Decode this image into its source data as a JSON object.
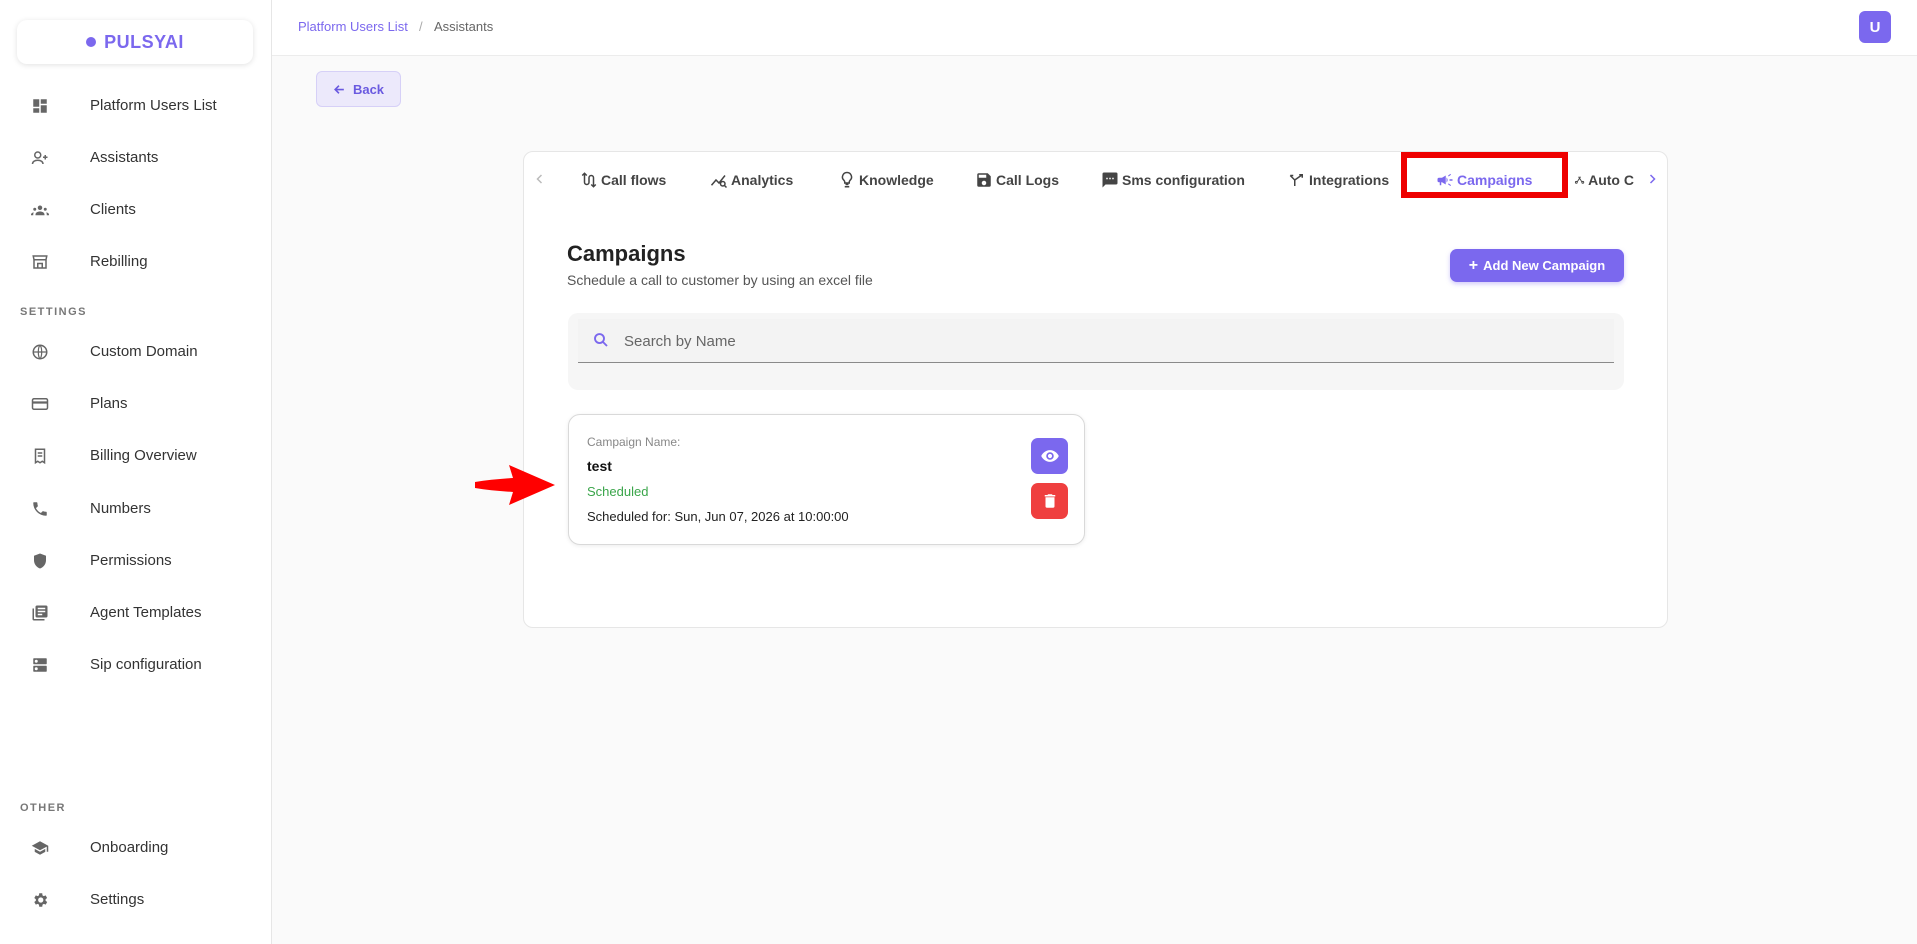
{
  "app": {
    "logo_text": "PULSYAI"
  },
  "sidebar": {
    "items": [
      {
        "label": "Platform Users List",
        "icon": "dashboard-icon"
      },
      {
        "label": "Assistants",
        "icon": "person-add-icon"
      },
      {
        "label": "Clients",
        "icon": "groups-icon"
      },
      {
        "label": "Rebilling",
        "icon": "storefront-icon"
      }
    ],
    "settings_label": "SETTINGS",
    "settings_items": [
      {
        "label": "Custom Domain",
        "icon": "globe-icon"
      },
      {
        "label": "Plans",
        "icon": "credit-card-icon"
      },
      {
        "label": "Billing Overview",
        "icon": "receipt-icon"
      },
      {
        "label": "Numbers",
        "icon": "phone-icon"
      },
      {
        "label": "Permissions",
        "icon": "shield-icon"
      },
      {
        "label": "Agent Templates",
        "icon": "library-books-icon"
      },
      {
        "label": "Sip configuration",
        "icon": "dns-icon"
      }
    ],
    "other_label": "OTHER",
    "other_items": [
      {
        "label": "Onboarding",
        "icon": "school-icon"
      },
      {
        "label": "Settings",
        "icon": "gear-icon"
      }
    ]
  },
  "header": {
    "breadcrumb": [
      "Platform Users List",
      "Assistants"
    ],
    "breadcrumb_sep": "/",
    "avatar_letter": "U"
  },
  "back_button": {
    "label": "Back"
  },
  "tabs": [
    {
      "label": "Call flows",
      "icon": "call-flows-icon"
    },
    {
      "label": "Analytics",
      "icon": "analytics-icon"
    },
    {
      "label": "Knowledge",
      "icon": "lightbulb-icon"
    },
    {
      "label": "Call Logs",
      "icon": "save-icon"
    },
    {
      "label": "Sms configuration",
      "icon": "sms-icon"
    },
    {
      "label": "Integrations",
      "icon": "merge-icon"
    },
    {
      "label": "Campaigns",
      "icon": "campaign-icon",
      "active": true
    },
    {
      "label": "Auto C",
      "icon": "auto-icon"
    }
  ],
  "main": {
    "title": "Campaigns",
    "subtitle": "Schedule a call to customer by using an excel file",
    "add_button_label": "Add New Campaign",
    "add_button_plus": "+",
    "search": {
      "placeholder": "Search by Name",
      "value": ""
    }
  },
  "campaigns": [
    {
      "name_label": "Campaign Name:",
      "name": "test",
      "status": "Scheduled",
      "scheduled_for": "Scheduled for: Sun, Jun 07, 2026 at 10:00:00"
    }
  ],
  "colors": {
    "accent": "#7b68ee",
    "danger": "#ef3f3f",
    "success": "#3aa54a",
    "highlight": "#ee0000"
  }
}
